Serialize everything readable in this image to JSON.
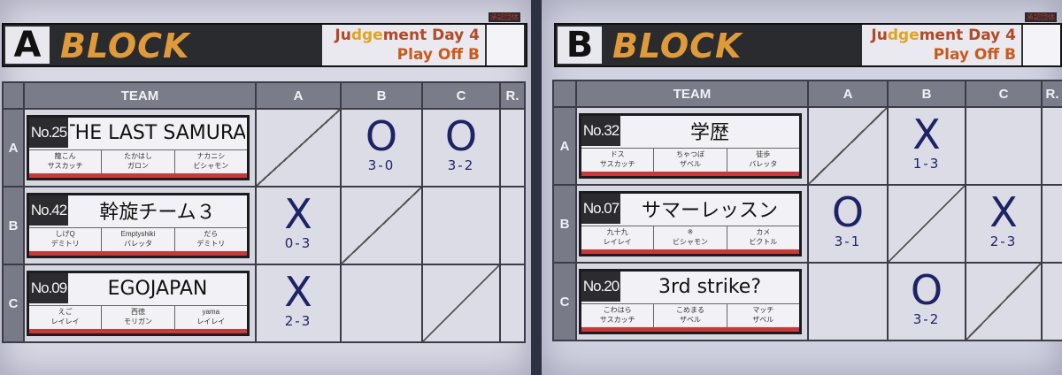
{
  "blocks": [
    {
      "letter": "A",
      "word": "BLOCK",
      "event_line1_pre": "Ju",
      "event_line1_hi": "dge",
      "event_line1_post": "ment Day 4",
      "event_line2": "Play Off B",
      "sign_label": "承認団体",
      "headers": {
        "team": "TEAM",
        "a": "A",
        "b": "B",
        "c": "C",
        "r": "R."
      },
      "rows": [
        {
          "label": "A",
          "no": "No.25",
          "name": "THE LAST SAMURAI",
          "players": [
            {
              "name": "龍こん",
              "char": "サスカッチ"
            },
            {
              "name": "たかはし",
              "char": "ガロン"
            },
            {
              "name": "ナカニシ",
              "char": "ビシャモン"
            }
          ],
          "results": [
            {
              "type": "diag"
            },
            {
              "type": "mark",
              "symbol": "O",
              "score": "3-0"
            },
            {
              "type": "mark",
              "symbol": "O",
              "score": "3-2"
            }
          ]
        },
        {
          "label": "B",
          "no": "No.42",
          "name": "幹旋チーム３",
          "players": [
            {
              "name": "しげQ",
              "char": "デミトリ"
            },
            {
              "name": "Emptyshiki",
              "char": "バレッタ"
            },
            {
              "name": "だら",
              "char": "デミトリ"
            }
          ],
          "results": [
            {
              "type": "mark",
              "symbol": "X",
              "score": "0-3"
            },
            {
              "type": "diag"
            },
            {
              "type": "empty"
            }
          ]
        },
        {
          "label": "C",
          "no": "No.09",
          "name": "EGOJAPAN",
          "players": [
            {
              "name": "えご",
              "char": "レイレイ"
            },
            {
              "name": "西徳",
              "char": "モリガン"
            },
            {
              "name": "yama",
              "char": "レイレイ"
            }
          ],
          "results": [
            {
              "type": "mark",
              "symbol": "X",
              "score": "2-3"
            },
            {
              "type": "empty"
            },
            {
              "type": "diag"
            }
          ]
        }
      ]
    },
    {
      "letter": "B",
      "word": "BLOCK",
      "event_line1_pre": "Ju",
      "event_line1_hi": "dge",
      "event_line1_post": "ment Day 4",
      "event_line2": "Play Off B",
      "sign_label": "承認団体",
      "headers": {
        "team": "TEAM",
        "a": "A",
        "b": "B",
        "c": "C",
        "r": "R."
      },
      "rows": [
        {
          "label": "A",
          "no": "No.32",
          "name": "学歴",
          "players": [
            {
              "name": "ドス",
              "char": "サスカッチ"
            },
            {
              "name": "ちゃつぼ",
              "char": "ザベル"
            },
            {
              "name": "徒歩",
              "char": "バレッタ"
            }
          ],
          "results": [
            {
              "type": "diag"
            },
            {
              "type": "mark",
              "symbol": "X",
              "score": "1-3"
            },
            {
              "type": "empty"
            }
          ]
        },
        {
          "label": "B",
          "no": "No.07",
          "name": "サマーレッスン",
          "players": [
            {
              "name": "九十九",
              "char": "レイレイ"
            },
            {
              "name": "※",
              "char": "ビシャモン"
            },
            {
              "name": "カメ",
              "char": "ビクトル"
            }
          ],
          "results": [
            {
              "type": "mark",
              "symbol": "O",
              "score": "3-1"
            },
            {
              "type": "diag"
            },
            {
              "type": "mark",
              "symbol": "X",
              "score": "2-3"
            }
          ]
        },
        {
          "label": "C",
          "no": "No.20",
          "name": "3rd strike?",
          "players": [
            {
              "name": "こわはら",
              "char": "サスカッチ"
            },
            {
              "name": "こめまる",
              "char": "ザベル"
            },
            {
              "name": "マッチ",
              "char": "ザベル"
            }
          ],
          "results": [
            {
              "type": "empty"
            },
            {
              "type": "mark",
              "symbol": "O",
              "score": "3-2"
            },
            {
              "type": "diag"
            }
          ]
        }
      ]
    }
  ]
}
